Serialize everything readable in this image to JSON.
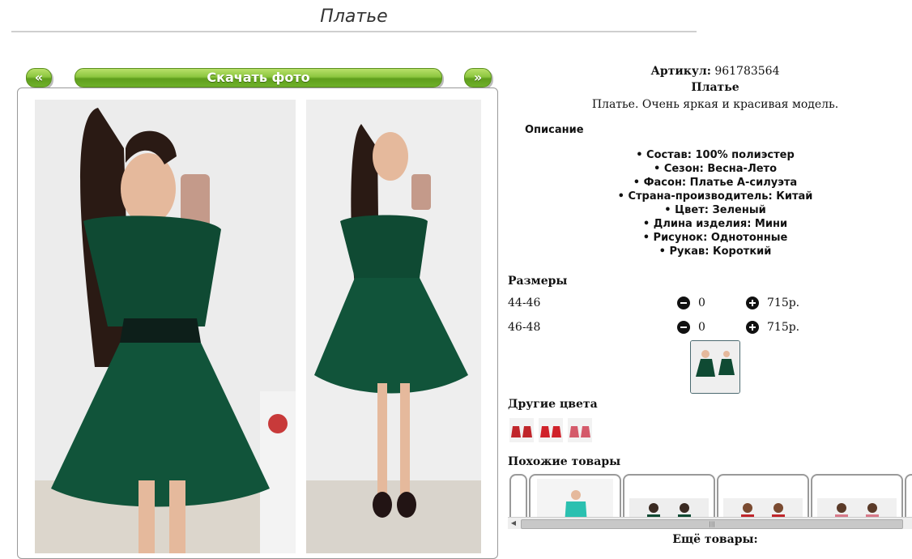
{
  "page_title": "Платье",
  "gallery": {
    "prev_label": "«",
    "download_label": "Скачать фото",
    "next_label": "»"
  },
  "product": {
    "article_label": "Артикул:",
    "article_value": "961783564",
    "name": "Платье",
    "short_description": "Платье. Очень яркая и красивая модель.",
    "description_heading": "Описание",
    "properties": [
      "Состав: 100% полиэстер",
      "Сезон: Весна-Лето",
      "Фасон: Платье А-силуэта",
      "Страна-производитель: Китай",
      "Цвет: Зеленый",
      "Длина изделия: Мини",
      "Рисунок: Однотонные",
      "Рукав: Короткий"
    ]
  },
  "sizes": {
    "heading": "Размеры",
    "rows": [
      {
        "size": "44-46",
        "qty": "0",
        "price": "715р."
      },
      {
        "size": "46-48",
        "qty": "0",
        "price": "715р."
      }
    ]
  },
  "other_colors_heading": "Другие цвета",
  "similar_heading": "Похожие товары",
  "more_label": "Ещё товары:",
  "colors": {
    "dress_green": "#0f4a33",
    "dress_red": "#c0262b",
    "dress_pink": "#d45a6a",
    "accent_green": "#6eb02a"
  }
}
